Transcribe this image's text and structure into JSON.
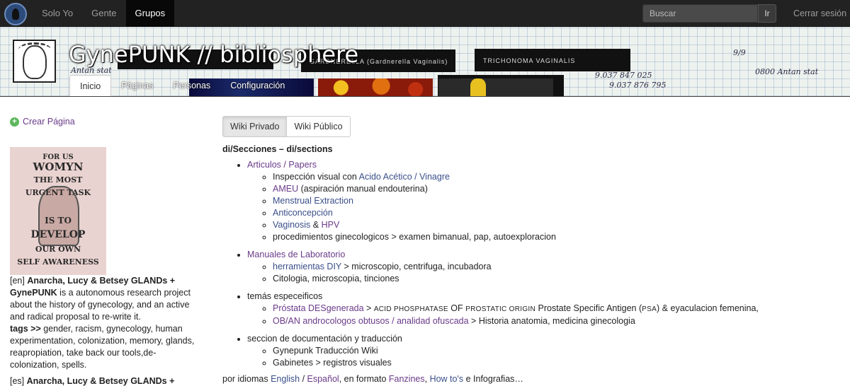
{
  "topbar": {
    "nav": [
      "Solo Yo",
      "Gente",
      "Grupos"
    ],
    "search_placeholder": "Buscar",
    "search_button": "Ir",
    "logout": "Cerrar sesión"
  },
  "banner": {
    "title": "GynePUNK // bibliosphere",
    "box_label_1": "GARDNERELLA (Gardnerella Vaginalis)",
    "box_label_2": "TRICHONOMA VAGINALIS",
    "tabs": [
      "Inicio",
      "Páginas",
      "Personas",
      "Configuración"
    ]
  },
  "sidebar": {
    "create_page": "Crear Página",
    "poster_text": [
      "FOR US",
      "WOMYN",
      "THE MOST",
      "URGENT TASK",
      "IS TO",
      "DEVELOP",
      "OUR OWN",
      "SELF AWARENESS"
    ],
    "desc": {
      "lang1": "[en] ",
      "name1": "Anarcha, Lucy & Betsey GLANDs + GynePUNK",
      "text1": " is a autonomous research project about the history of gynecology, and an active and radical proposal to re-write it.",
      "tags_label": "tags >>",
      "tags": " gender, racism, gynecology, human experimentation, colonization, memory, glands, reapropiation, take back our tools,de-colonization, spells.",
      "lang2": "[es] ",
      "name2": "Anarcha, Lucy & Betsey GLANDs +"
    }
  },
  "main": {
    "tabs": [
      "Wiki Privado",
      "Wiki Público"
    ],
    "section_title": "di/Secciones – di/sections",
    "s1": {
      "title": "Articulos / Papers",
      "i1_text": "Inspección visual con ",
      "i1_link": "Acido Acético / Vinagre",
      "i2_link": "AMEU",
      "i2_text": " (aspiración manual endouterina)",
      "i3_link": "Menstrual Extraction",
      "i4_link": "Anticoncepción",
      "i5_link1": "Vaginosis",
      "i5_amp": " & ",
      "i5_link2": "HPV",
      "i6_text": "procedimientos ginecologicos > examen bimanual, pap, autoexploracion"
    },
    "s2": {
      "title": "Manuales de Laboratorio",
      "i1_link": "herramientas DIY",
      "i1_text": " > microscopio, centrifuga, incubadora",
      "i2_text": "Citologia, microscopia, tinciones"
    },
    "s3": {
      "title": "temás especeificos",
      "i1_link": "Próstata DESgenerada",
      "i1_gt": " > ",
      "i1_sc1": "ACID PHOSPHATASE",
      "i1_of": " OF ",
      "i1_sc2": "PROSTATIC ORIGIN",
      "i1_t1": " Prostate Specific Antigen (",
      "i1_sc3": "PSA",
      "i1_t2": ") & eyaculacion femenina,",
      "i2_link": "OB/AN androcologos obtusos / analidad ofuscada",
      "i2_text": " > Historia anatomia, medicina ginecologia"
    },
    "s4": {
      "title": "seccion de documentación y traducción",
      "i1_text": "Gynepunk Traducción Wiki",
      "i2_text": "Gabinetes > registros visuales"
    },
    "footer": {
      "t1": "por idiomas ",
      "l1": "English",
      "slash": " / ",
      "l2": "Español",
      "t2": ", en formato ",
      "l3": "Fanzines",
      "comma": ", ",
      "l4": "How to's",
      "t3": " e Infografias…"
    }
  }
}
